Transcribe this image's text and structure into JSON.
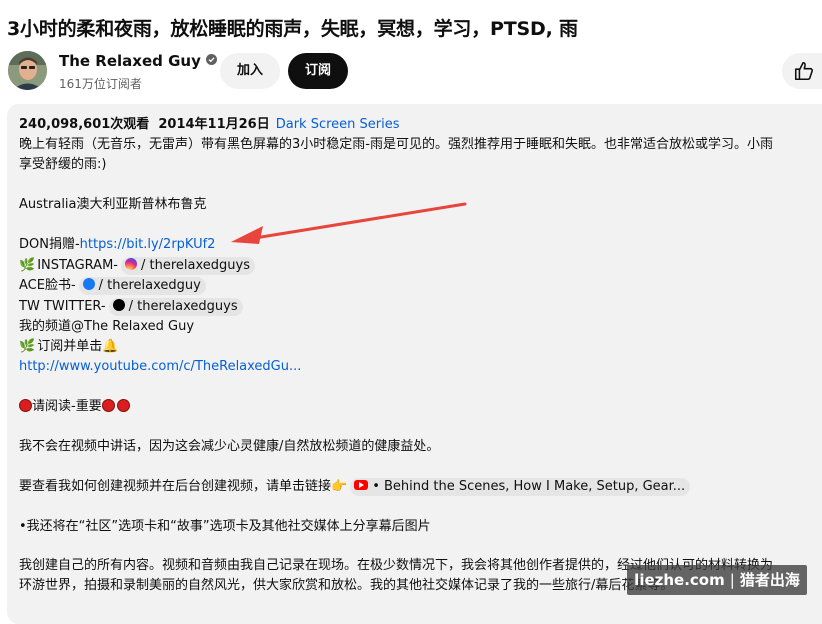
{
  "video": {
    "title": "3小时的柔和夜雨，放松睡眠的雨声，失眠，冥想，学习，PTSD, 雨"
  },
  "channel": {
    "name": "The Relaxed Guy",
    "subscribers": "161万位订阅者",
    "join_label": "加入",
    "subscribe_label": "订阅"
  },
  "actions": {
    "like_icon": "thumbs-up-icon"
  },
  "description": {
    "views": "240,098,601次观看",
    "date": "2014年11月26日",
    "series": "Dark Screen Series",
    "intro_line1": "晚上有轻雨（无音乐，无雷声）带有黑色屏幕的3小时稳定雨-雨是可见的。强烈推荐用于睡眠和失眠。也非常适合放松或学习。小雨",
    "intro_line2": "享受舒缓的雨:)",
    "location": "Australia澳大利亚斯普林布鲁克",
    "donate_prefix": "DON捐赠-",
    "donate_link": "https://bit.ly/2rpKUf2",
    "instagram_prefix": "INSTAGRAM-",
    "instagram_handle": "/ therelaxedguys",
    "facebook_prefix": "ACE脸书-",
    "facebook_handle": "/ therelaxedguy",
    "twitter_prefix": "TW TWITTER-",
    "twitter_handle": "/ therelaxedguys",
    "my_channel": "我的频道@The Relaxed Guy",
    "subscribe_click": "订阅并单击",
    "channel_url": "http://www.youtube.com/c/TheRelaxedGu...",
    "please_read": "请阅读-重要",
    "no_talking": "我不会在视频中讲话，因为这会减少心灵健康/自然放松频道的健康益处。",
    "behind_prefix": "要查看我如何创建视频并在后台创建视频，请单击链接",
    "behind_chip": "• Behind the Scenes, How I Make, Setup, Gear...",
    "community": "•我还将在“社区”选项卡和“故事”选项卡及其他社交媒体上分享幕后图片",
    "outro_line1": "我创建自己的所有内容。视频和音频由我自己记录在现场。在极少数情况下，我会将其他创作者提供的，经过他们认可的材料转换为",
    "outro_line2": "环游世界，拍摄和录制美丽的自然风光，供大家欣赏和放松。我的其他社交媒体记录了我的一些旅行/幕后花絮等。"
  },
  "watermark": {
    "site": "liezhe.com",
    "name": "猎者出海"
  },
  "colors": {
    "link": "#065fd4",
    "panel_bg": "#f2f2f2",
    "arrow": "#e8453c",
    "subscribe_bg": "#0f0f0f"
  }
}
